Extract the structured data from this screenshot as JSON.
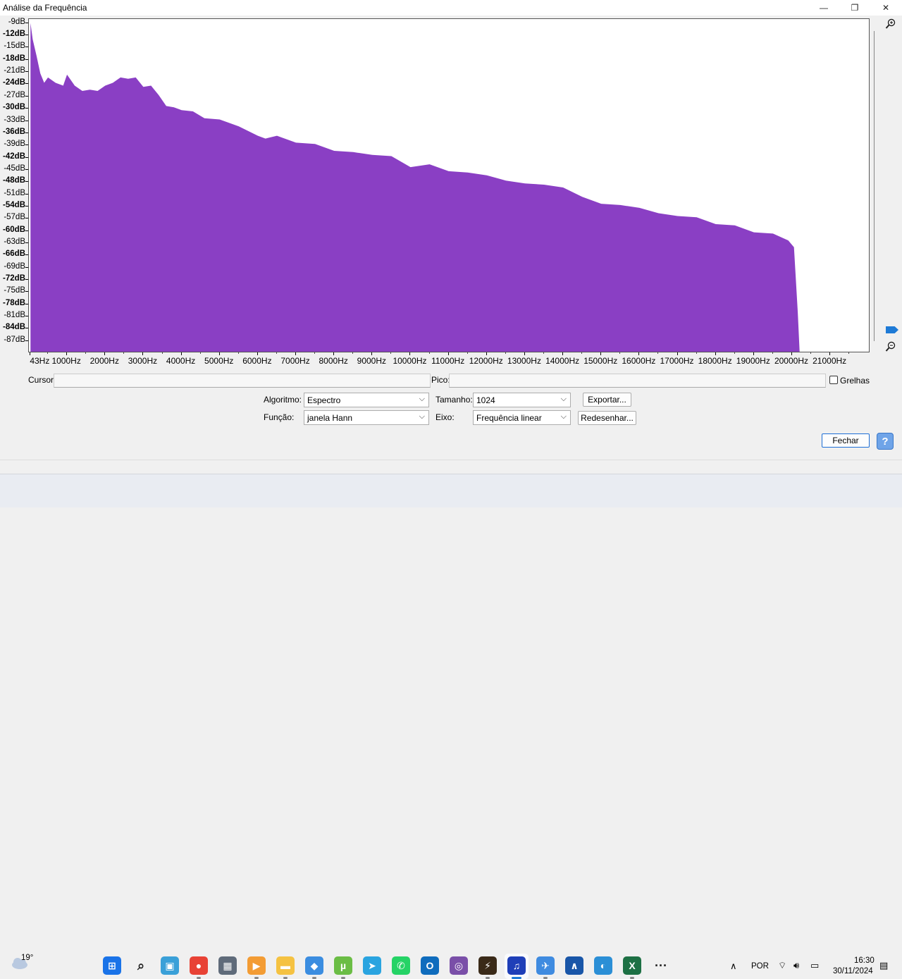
{
  "window": {
    "title": "Análise da Frequência",
    "minimize_glyph": "—",
    "maximize_glyph": "❐",
    "close_glyph": "✕"
  },
  "colors": {
    "spectrum_fill": "#8a3fc4",
    "plot_background": "#ffffff",
    "accent": "#1e7ad6"
  },
  "chart_data": {
    "type": "area",
    "title": "",
    "xlabel": "",
    "ylabel": "",
    "x_unit": "Hz",
    "y_unit": "dB",
    "xlim": [
      0,
      22050
    ],
    "ylim": [
      -90,
      -8
    ],
    "grid": false,
    "y_tick_labels": [
      "-9dB",
      "-12dB",
      "-15dB",
      "-18dB",
      "-21dB",
      "-24dB",
      "-27dB",
      "-30dB",
      "-33dB",
      "-36dB",
      "-39dB",
      "-42dB",
      "-45dB",
      "-48dB",
      "-51dB",
      "-54dB",
      "-57dB",
      "-60dB",
      "-63dB",
      "-66dB",
      "-69dB",
      "-72dB",
      "-75dB",
      "-78dB",
      "-81dB",
      "-84dB",
      "-87dB"
    ],
    "y_tick_values": [
      -9,
      -12,
      -15,
      -18,
      -21,
      -24,
      -27,
      -30,
      -33,
      -36,
      -39,
      -42,
      -45,
      -48,
      -51,
      -54,
      -57,
      -60,
      -63,
      -66,
      -69,
      -72,
      -75,
      -78,
      -81,
      -84,
      -87
    ],
    "x_tick_labels": [
      "43Hz",
      "1000Hz",
      "2000Hz",
      "3000Hz",
      "4000Hz",
      "5000Hz",
      "6000Hz",
      "7000Hz",
      "8000Hz",
      "9000Hz",
      "10000Hz",
      "11000Hz",
      "12000Hz",
      "13000Hz",
      "14000Hz",
      "15000Hz",
      "16000Hz",
      "17000Hz",
      "18000Hz",
      "19000Hz",
      "20000Hz",
      "21000Hz"
    ],
    "x_tick_values": [
      43,
      1000,
      2000,
      3000,
      4000,
      5000,
      6000,
      7000,
      8000,
      9000,
      10000,
      11000,
      12000,
      13000,
      14000,
      15000,
      16000,
      17000,
      18000,
      19000,
      20000,
      21000
    ],
    "series": [
      {
        "x": [
          43,
          100,
          200,
          300,
          400,
          500,
          700,
          900,
          1000,
          1200,
          1400,
          1600,
          1800,
          2000,
          2200,
          2400,
          2600,
          2800,
          3000,
          3200,
          3400,
          3600,
          3800,
          4000,
          4300,
          4600,
          5000,
          5500,
          6000,
          6200,
          6500,
          7000,
          7500,
          8000,
          8500,
          9000,
          9500,
          10000,
          10500,
          11000,
          11500,
          12000,
          12500,
          13000,
          13500,
          14000,
          14500,
          15000,
          15500,
          16000,
          16500,
          17000,
          17500,
          18000,
          18500,
          19000,
          19500,
          19900,
          20050,
          20150,
          20200
        ],
        "y": [
          -9,
          -13,
          -17,
          -21,
          -24,
          -22,
          -24,
          -24,
          -22,
          -24,
          -26,
          -25,
          -26,
          -24,
          -24,
          -22,
          -23,
          -22,
          -25,
          -24,
          -27,
          -29,
          -30,
          -30,
          -31,
          -32,
          -33,
          -34,
          -37,
          -37,
          -37,
          -38,
          -39,
          -40,
          -41,
          -41,
          -42,
          -44,
          -44,
          -45,
          -46,
          -46,
          -48,
          -48,
          -49,
          -49,
          -52,
          -53,
          -54,
          -54,
          -56,
          -56,
          -57,
          -58,
          -59,
          -60,
          -61,
          -62,
          -64,
          -80,
          -90
        ]
      }
    ]
  },
  "cursor": {
    "label": "Cursor:",
    "value": ""
  },
  "peak": {
    "label": "Pico:",
    "value": ""
  },
  "grid_option": {
    "label": "Grelhas",
    "checked": false
  },
  "controls": {
    "algorithm_label": "Algoritmo:",
    "algorithm_value": "Espectro",
    "function_label": "Função:",
    "function_value": "janela Hann",
    "size_label": "Tamanho:",
    "size_value": "1024",
    "axis_label": "Eixo:",
    "axis_value": "Frequência linear",
    "export_label": "Exportar...",
    "redraw_label": "Redesenhar..."
  },
  "close_label": "Fechar",
  "help_label": "?",
  "taskbar": {
    "weather_temp": "19°",
    "language": "POR",
    "time": "16:30",
    "date": "30/11/2024",
    "more_glyph": "···",
    "chevron_glyph": "∧",
    "icons": [
      {
        "name": "start-icon",
        "color": "#1a73e8",
        "glyph": "⊞"
      },
      {
        "name": "search-icon",
        "color": "transparent",
        "glyph": "⌕"
      },
      {
        "name": "widgets-icon",
        "color": "#3aa0d8",
        "glyph": "▣"
      },
      {
        "name": "chrome-icon",
        "color": "#e84235",
        "glyph": "●"
      },
      {
        "name": "calculator-icon",
        "color": "#5f6b7a",
        "glyph": "▦"
      },
      {
        "name": "media-player-icon",
        "color": "#f39c34",
        "glyph": "▶"
      },
      {
        "name": "file-explorer-icon",
        "color": "#f5c242",
        "glyph": "▬"
      },
      {
        "name": "photos-icon",
        "color": "#3b8de0",
        "glyph": "◆"
      },
      {
        "name": "utorrent-icon",
        "color": "#6bbd45",
        "glyph": "µ"
      },
      {
        "name": "telegram-icon",
        "color": "#2aa4e0",
        "glyph": "➤"
      },
      {
        "name": "whatsapp-icon",
        "color": "#25d366",
        "glyph": "✆"
      },
      {
        "name": "outlook-icon",
        "color": "#0f6cbd",
        "glyph": "O"
      },
      {
        "name": "browser-icon",
        "color": "#7a4fa8",
        "glyph": "◎"
      },
      {
        "name": "winamp-icon",
        "color": "#3a2a18",
        "glyph": "⚡"
      },
      {
        "name": "audacity-icon",
        "color": "#1f3fb8",
        "glyph": "♫"
      },
      {
        "name": "plane-app-icon",
        "color": "#3f8be0",
        "glyph": "✈"
      },
      {
        "name": "arc-app-icon",
        "color": "#1956a8",
        "glyph": "∧"
      },
      {
        "name": "edge-icon",
        "color": "#2b8fd6",
        "glyph": "◐"
      },
      {
        "name": "excel-icon",
        "color": "#1d7044",
        "glyph": "X"
      },
      {
        "name": "more-apps-icon",
        "color": "transparent",
        "glyph": "···"
      }
    ]
  }
}
